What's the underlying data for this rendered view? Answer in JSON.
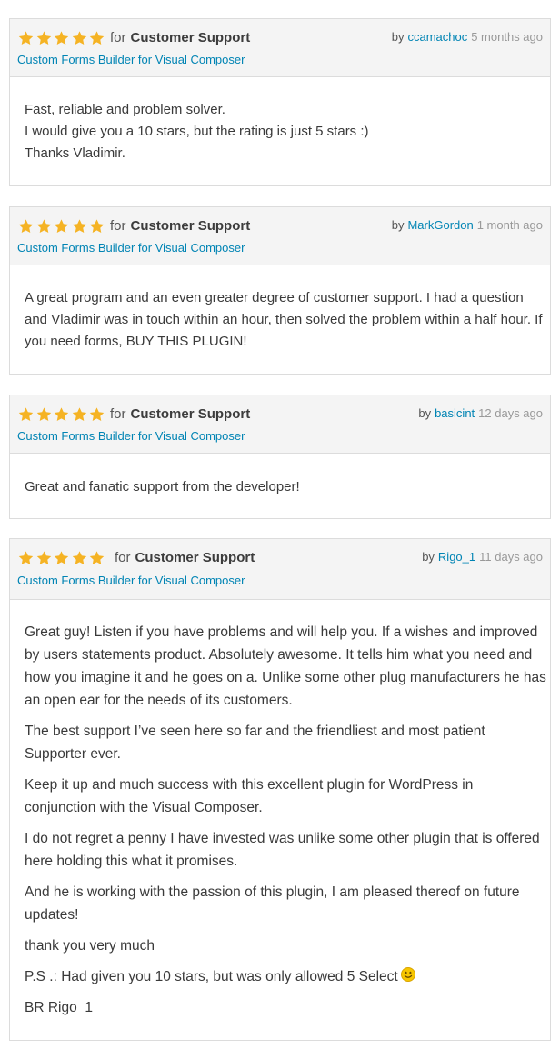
{
  "colors": {
    "star": "#f5b324",
    "link": "#0084b4",
    "header_bg": "#f4f4f4",
    "border": "#dcdcdc"
  },
  "icons": {
    "star": "star-icon",
    "smiley": "smiley-emoji-icon"
  },
  "reviews": [
    {
      "rating": 5,
      "for_word": "for",
      "category": "Customer Support",
      "product": "Custom Forms Builder for Visual Composer",
      "by_word": "by",
      "author": "ccamachoc",
      "time_ago": "5 months ago",
      "paragraphs": [
        "Fast, reliable and problem solver.",
        "I would give you a 10 stars, but the rating is just 5 stars :)",
        "Thanks Vladimir."
      ]
    },
    {
      "rating": 5,
      "for_word": "for",
      "category": "Customer Support",
      "product": "Custom Forms Builder for Visual Composer",
      "by_word": "by",
      "author": "MarkGordon",
      "time_ago": "1 month ago",
      "paragraphs": [
        "A great program and an even greater degree of customer support. I had a question and Vladimir was in touch within an hour, then solved the problem within a half hour. If you need forms, BUY THIS PLUGIN!"
      ]
    },
    {
      "rating": 5,
      "for_word": "for",
      "category": "Customer Support",
      "product": "Custom Forms Builder for Visual Composer",
      "by_word": "by",
      "author": "basicint",
      "time_ago": "12 days ago",
      "paragraphs": [
        "Great and fanatic support from the developer!"
      ]
    },
    {
      "rating": 5,
      "for_word": "for",
      "category": "Customer Support",
      "product": "Custom Forms Builder for Visual Composer",
      "by_word": "by",
      "author": "Rigo_1",
      "time_ago": "11 days ago",
      "paragraphs": [
        "Great guy! Listen if you have problems and will help you. If a wishes and improved by users statements product. Absolutely awesome. It tells him what you need and how you imagine it and he goes on a. Unlike some other plug manufacturers he has an open ear for the needs of its customers.",
        "The best support I’ve seen here so far and the friendliest and most patient Supporter ever.",
        "Keep it up and much success with this excellent plugin for WordPress in conjunction with the Visual Composer.",
        "I do not regret a penny I have invested was unlike some other plugin that is offered here holding this what it promises.",
        "And he is working with the passion of this plugin, I am pleased thereof on future updates!",
        "thank you very much",
        "P.S .: Had given you 10 stars, but was only allowed 5 Select",
        "BR Rigo_1"
      ]
    }
  ]
}
